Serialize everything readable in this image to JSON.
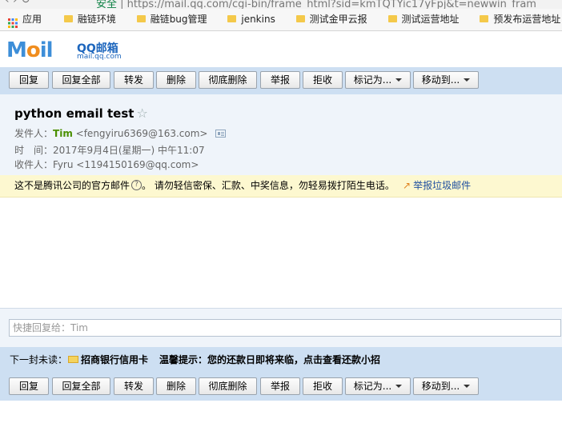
{
  "browser": {
    "secure_label": "安全",
    "url": "https://mail.qq.com/cgi-bin/frame_html?sid=kmTQTYic17yFpj&t=newwin_fram",
    "bookmarks": [
      {
        "label": "应用",
        "icon": "apps-icon"
      },
      {
        "label": "融链环境",
        "icon": "folder-icon"
      },
      {
        "label": "融链bug管理",
        "icon": "folder-icon"
      },
      {
        "label": "jenkins",
        "icon": "folder-icon"
      },
      {
        "label": "测试金甲云报",
        "icon": "folder-icon"
      },
      {
        "label": "测试运营地址",
        "icon": "folder-icon"
      },
      {
        "label": "预发布运营地址",
        "icon": "folder-icon"
      }
    ]
  },
  "logo": {
    "word_a": "M",
    "word_b": "o",
    "word_c": "il",
    "cn": "QQ邮箱",
    "domain": "mail.qq.com"
  },
  "toolbar": {
    "reply": "回复",
    "reply_all": "回复全部",
    "forward": "转发",
    "delete": "删除",
    "delete_permanent": "彻底删除",
    "report": "举报",
    "reject": "拒收",
    "mark_as": "标记为...",
    "move_to": "移动到..."
  },
  "mail": {
    "subject": "python email test",
    "from_label": "发件人：",
    "from_name": "Tim",
    "from_email": "<fengyiru6369@163.com>",
    "time_label": "时　间：",
    "time_value": "2017年9月4日(星期一) 中午11:07",
    "to_label": "收件人：",
    "to_value": "Fyru <1194150169@qq.com>"
  },
  "warning": {
    "text_a": "这不是腾讯公司的官方邮件",
    "help_glyph": "?",
    "text_b": "。 请勿轻信密保、汇款、中奖信息，勿轻易拨打陌生电话。",
    "report_link": "举报垃圾邮件"
  },
  "quick_reply": {
    "placeholder": "快捷回复给：Tim"
  },
  "next_mail": {
    "label": "下一封未读：",
    "title": "招商银行信用卡",
    "tip": "温馨提示：您的还款日即将来临，点击查看还款小招"
  },
  "colors": {
    "toolbar_bg": "#cddff2",
    "header_bg": "#eff4fa",
    "warning_bg": "#fdf8d0",
    "sender_name": "#4a8f00",
    "link": "#1d4e9f"
  }
}
